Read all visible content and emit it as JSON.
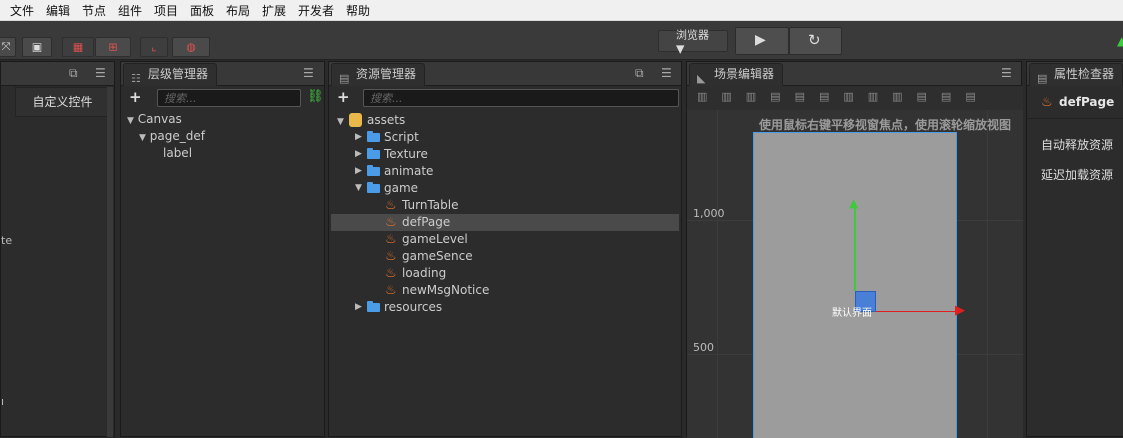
{
  "menubar": [
    "文件",
    "编辑",
    "节点",
    "组件",
    "项目",
    "面板",
    "布局",
    "扩展",
    "开发者",
    "帮助"
  ],
  "toolbar": {
    "preview_select": "浏览器 ▼"
  },
  "left_panel": {
    "custom_widget_button": "自定义控件",
    "partial_text_1": "te",
    "partial_text_2": "ı"
  },
  "hierarchy": {
    "tab_label": "层级管理器",
    "search_placeholder": "搜索...",
    "nodes": [
      "Canvas",
      "page_def",
      "label"
    ]
  },
  "assets": {
    "tab_label": "资源管理器",
    "search_placeholder": "搜索...",
    "root": "assets",
    "items": {
      "script": "Script",
      "texture": "Texture",
      "animate": "animate",
      "game": "game",
      "turntable": "TurnTable",
      "defpage": "defPage",
      "gamelevel": "gameLevel",
      "gamesence": "gameSence",
      "loading": "loading",
      "newmsgnotice": "newMsgNotice",
      "resources": "resources"
    }
  },
  "scene": {
    "tab_label": "场景编辑器",
    "hint": "使用鼠标右键平移视窗焦点，使用滚轮缩放视图",
    "y_label_1": "1,000",
    "y_label_2": "500",
    "node_label": "默认界面"
  },
  "inspector": {
    "tab_label": "属性检查器",
    "node_name": "defPage",
    "auto_release": "自动释放资源",
    "lazy_load": "延迟加载资源"
  },
  "colors": {
    "accent_blue": "#4a9be8",
    "fire_orange": "#e8752a",
    "axis_green": "#3fc93f",
    "axis_red": "#e02020"
  }
}
